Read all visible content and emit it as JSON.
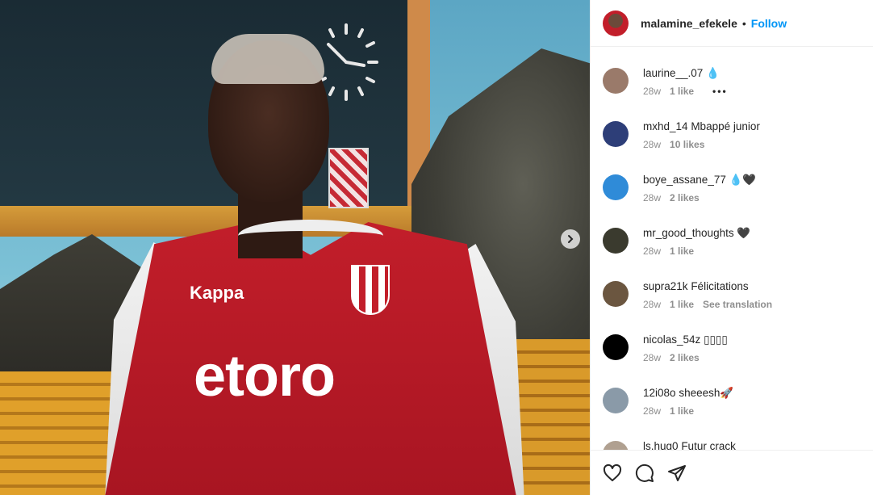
{
  "post": {
    "author": "malamine_efekele",
    "follow_label": "Follow",
    "separator": "•",
    "photo": {
      "sponsor_text": "etoro",
      "brand_text": "Kappa"
    }
  },
  "comments": [
    {
      "user": "laurine__.07",
      "text": "💧",
      "age": "28w",
      "likes": "1 like",
      "avatar_color": "#9a7a6a",
      "more": "•••"
    },
    {
      "user": "mxhd_14",
      "text": "Mbappé junior",
      "age": "28w",
      "likes": "10 likes",
      "avatar_color": "#2d3e78"
    },
    {
      "user": "boye_assane_77",
      "text": "💧🖤",
      "age": "28w",
      "likes": "2 likes",
      "avatar_color": "#2f8bd8"
    },
    {
      "user": "mr_good_thoughts",
      "text": "🖤",
      "age": "28w",
      "likes": "1 like",
      "avatar_color": "#3a3a2e"
    },
    {
      "user": "supra21k",
      "text": "Félicitations",
      "age": "28w",
      "likes": "1 like",
      "avatar_color": "#6b5640",
      "translate": "See translation"
    },
    {
      "user": "nicolas_54z",
      "text": "▯▯▯▯",
      "age": "28w",
      "likes": "2 likes",
      "avatar_color": "#000000"
    },
    {
      "user": "12i08o",
      "text": "sheeesh🚀",
      "age": "28w",
      "likes": "1 like",
      "avatar_color": "#8a9aa8"
    },
    {
      "user": "ls.hug0",
      "text": "Futur crack",
      "age": "",
      "likes": "",
      "avatar_color": "#b0a090"
    }
  ],
  "colors": {
    "follow_blue": "#0095f6",
    "jersey_red": "#c21e2a"
  },
  "icons": [
    "heart-icon",
    "comment-icon",
    "share-icon",
    "chevron-right-icon"
  ]
}
